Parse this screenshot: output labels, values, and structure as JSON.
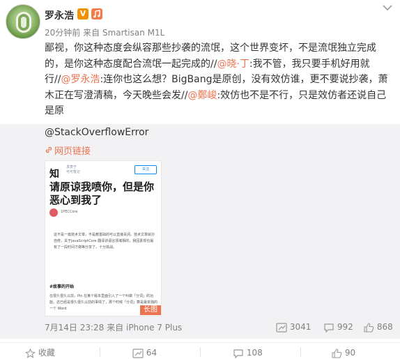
{
  "post": {
    "username": "罗永浩",
    "verified_badge": "V",
    "time": "20分钟前",
    "source_prefix": "来自",
    "source": "Smartisan M1L",
    "content": {
      "part1": "鄙视，你这种态度会纵容那些抄袭的流氓，这个世界变坏，不是流氓独立完成的，是你这种态度配合流氓一起完成的//",
      "mention1": "@晓·丁",
      "part2": ":我不管，我只要手机好用就行//",
      "mention2": "@罗永浩",
      "part3": ":连你也这么想？BigBang是原创，没有效仿谁，更不要说抄袭，萧木正在写澄清稿，今天晚些会发//",
      "mention3": "@鄭峻",
      "part4": ":效仿也不是不行，只是效仿者还说自己是原"
    }
  },
  "repost": {
    "user": "@StackOverflowError",
    "web_link_label": "网页链接",
    "thumbnail": {
      "logo": "知",
      "source_line1": "发表于",
      "source_line2": "可可笔记",
      "follow_button": "关注",
      "title": "请原谅我喷你，但是你恶心到我了",
      "author": "1PECCore",
      "body": "这不是一篇技术文章，不是教基础的可以直接关闭。技术文章就抄自修，关于JavaScriptCore 翻译讲语言领域相的，我因素现也最有了一段时间才做等分享了，十分挑战。",
      "section_heading": "#故事的开始",
      "body2": "在很久很久以前，Pin 在某个版本里面引入了一个叫做「分词」的功能。这已经是很久很久以前的事情了，那个时候「分词」算是最单独的一个 Word",
      "long_image_tag": "长图"
    },
    "time": "7月14日 23:28",
    "source_prefix": "来自",
    "source": "iPhone 7 Plus",
    "stats": {
      "forwards": "3041",
      "comments": "992",
      "likes": "868"
    }
  },
  "actions": {
    "favorite": "收藏",
    "forward_count": "64",
    "comment_count": "108",
    "like_count": "90"
  },
  "colors": {
    "accent": "#eb7350",
    "vip_badge": "#f29100",
    "muted": "#808080",
    "repost_bg": "#f2f2f5"
  },
  "icons": {
    "more": "chevron-down-icon",
    "music": "music-badge-icon",
    "link": "link-icon",
    "forward": "forward-icon",
    "comment": "comment-icon",
    "like": "thumbs-up-icon",
    "favorite": "star-icon"
  }
}
